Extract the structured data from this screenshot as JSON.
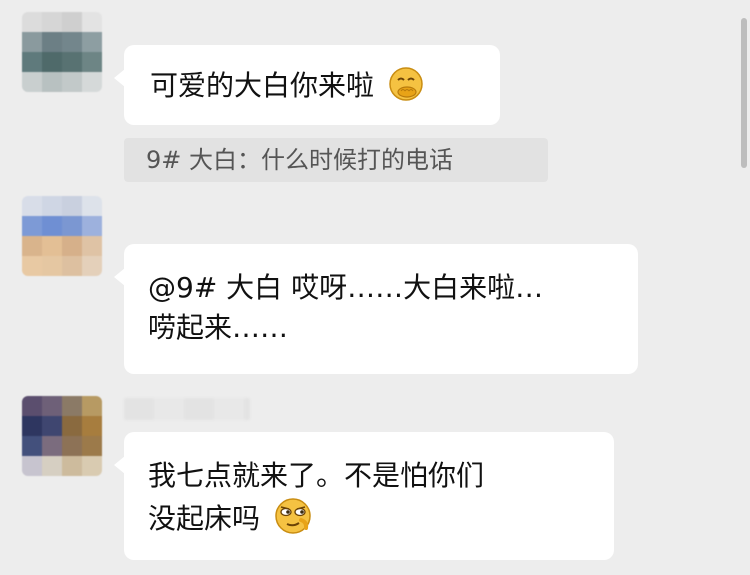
{
  "messages": [
    {
      "text": "可爱的大白你来啦",
      "emoji": "covering-mouth-smile-emoji",
      "quote": "9# 大白：什么时候打的电话"
    },
    {
      "lines": [
        "@9# 大白 哎呀……大白来啦…",
        "唠起来……"
      ]
    },
    {
      "lines": [
        "我七点就来了。不是怕你们",
        "没起床吗"
      ],
      "emoji": "sly-smirk-emoji"
    }
  ],
  "colors": {
    "background": "#ededed",
    "bubble": "#ffffff",
    "quote_bg": "#e2e2e2",
    "text": "#111111",
    "quote_text": "#555555",
    "emoji_yellow": "#f5c242"
  }
}
